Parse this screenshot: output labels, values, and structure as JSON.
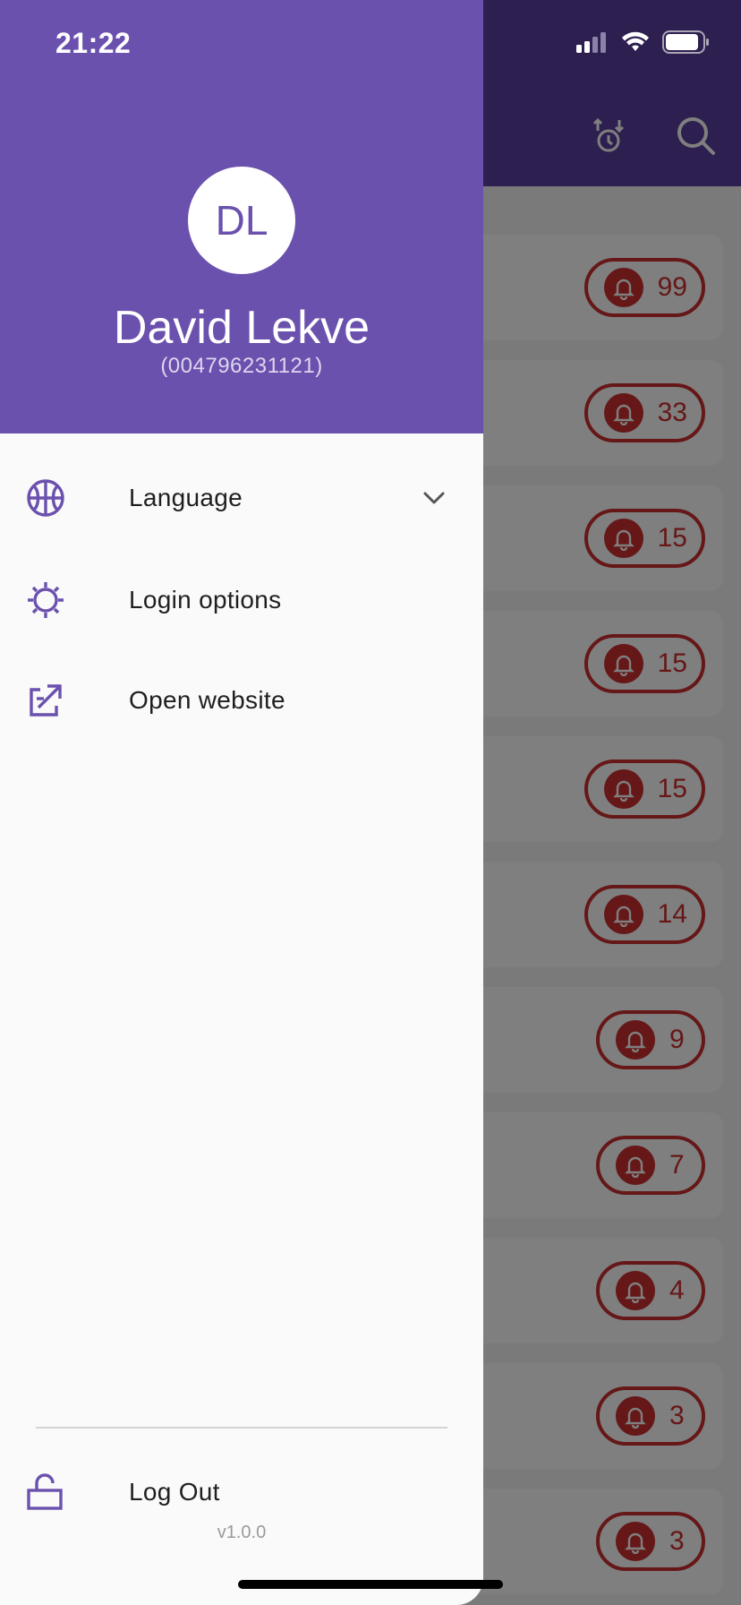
{
  "status_bar": {
    "time": "21:22"
  },
  "profile": {
    "initials": "DL",
    "name": "David Lekve",
    "phone": "(004796231121)"
  },
  "menu": {
    "items": [
      {
        "label": "Language",
        "icon": "globe-icon",
        "expandable": true
      },
      {
        "label": "Login options",
        "icon": "gear-icon"
      },
      {
        "label": "Open website",
        "icon": "external-link-icon"
      }
    ],
    "logout": {
      "label": "Log Out",
      "icon": "lock-icon"
    },
    "version": "v1.0.0"
  },
  "background_list": {
    "counts": [
      "99",
      "33",
      "15",
      "15",
      "15",
      "14",
      "9",
      "7",
      "4",
      "3",
      "3"
    ]
  },
  "colors": {
    "primary": "#6b51ae",
    "alert": "#cc2e2e"
  }
}
